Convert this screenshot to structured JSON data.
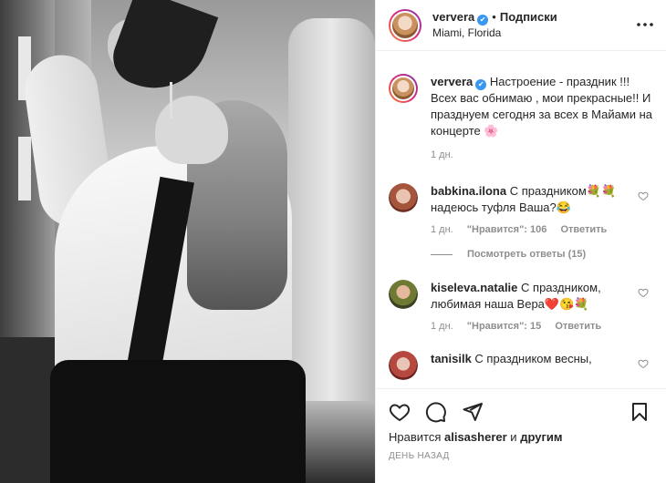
{
  "photo": {
    "alt": ""
  },
  "header": {
    "username": "ververa",
    "verified_mark": "✔",
    "separator": "•",
    "follow_label": "Подписки",
    "location": "Miami, Florida",
    "more_icon": "more-horizontal-icon"
  },
  "caption": {
    "username": "ververa",
    "text": "Настроение - праздник !!! Всех вас обнимаю , мои прекрасные!! И празднуем сегодня за всех в Майами на концерте 🌸",
    "time": "1 дн."
  },
  "comments": [
    {
      "username": "babkina.ilona",
      "text": "С праздником💐💐 надеюсь туфля Ваша?😂",
      "time": "1 дн.",
      "likes": "\"Нравится\": 106",
      "reply": "Ответить",
      "view_replies": "Посмотреть ответы (15)"
    },
    {
      "username": "kiseleva.natalie",
      "text": "С праздником, любимая наша Вера❤️😘💐",
      "time": "1 дн.",
      "likes": "\"Нравится\": 15",
      "reply": "Ответить"
    },
    {
      "username": "tanisilk",
      "text": "С праздником весны,"
    }
  ],
  "actions": {
    "like_icon": "heart-icon",
    "comment_icon": "comment-icon",
    "share_icon": "share-icon",
    "save_icon": "bookmark-icon",
    "likes_prefix": "Нравится",
    "likes_user": "alisasherer",
    "likes_conj": "и",
    "likes_others": "другим",
    "date": "ДЕНЬ НАЗАД"
  },
  "colors": {
    "verified": "#3897f0",
    "muted": "#8e8e8e",
    "text": "#262626"
  }
}
